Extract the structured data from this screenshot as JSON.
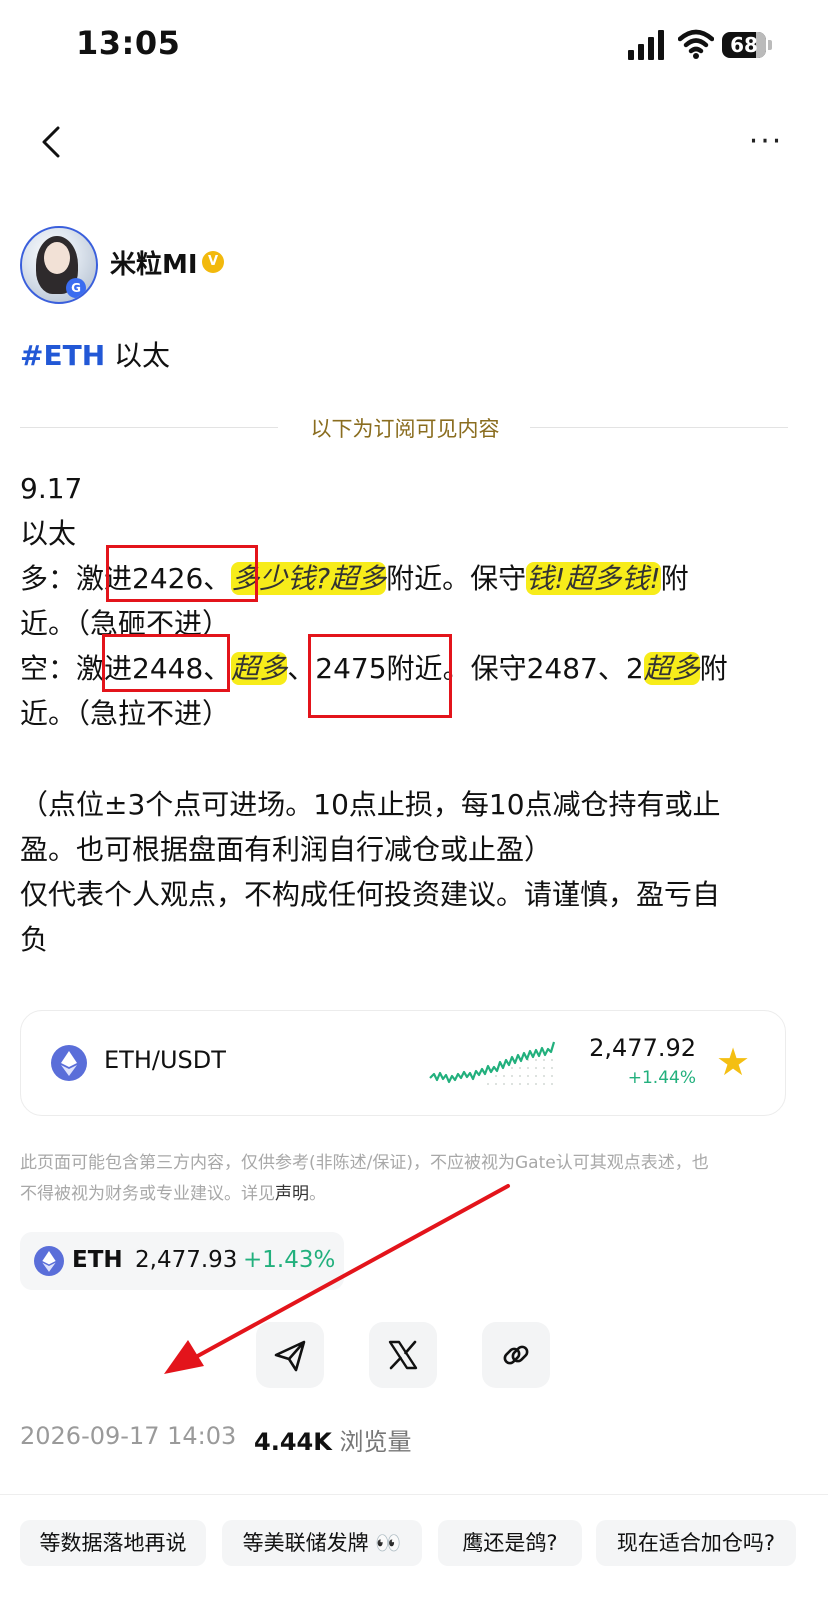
{
  "status": {
    "time": "13:05",
    "battery": "68"
  },
  "nav": {
    "back_icon": "chevron-left-icon",
    "more_label": "···"
  },
  "author": {
    "name": "米粒MI",
    "verified_badge": "V"
  },
  "post": {
    "hashtag": "#ETH",
    "tag_suffix": " 以太",
    "divider_text": "以下为订阅可见内容",
    "date_line": "9.17",
    "asset_line": "以太",
    "long_prefix": "多：激",
    "long_1": "进2426、",
    "long_hidden_1": "多少钱?超多",
    "long_near": "附近。保守",
    "long_hidden_2": "钱!超多钱!",
    "long_end": "附",
    "long_line2": "近。（急砸不进）",
    "short_prefix": "空：激",
    "short_1": "进2448、",
    "short_hidden_1": "超多",
    "short_2": "、2475附近",
    "short_mid": "。保守2487、2",
    "short_hidden_2": "超多",
    "short_end": "附",
    "short_line2": "近。（急拉不进）",
    "note_1": "（点位±3个点可进场。10点止损，每10点减仓持有或止",
    "note_2": "盈。也可根据盘面有利润自行减仓或止盈）",
    "note_3": "仅代表个人观点，不构成任何投资建议。请谨慎，盈亏自",
    "note_4": "负"
  },
  "ticker_card": {
    "pair": "ETH/USDT",
    "price": "2,477.92",
    "change": "+1.44%"
  },
  "disclaimer": {
    "line_1": "此页面可能包含第三方内容，仅供参考(非陈述/保证)，不应被视为Gate认可其观点表述，也",
    "line_2": "不得被视为财务或专业建议。详见",
    "link": "声明",
    "end": "。"
  },
  "coin_chip": {
    "symbol": "ETH",
    "price": "2,477.93",
    "change": "+1.43%"
  },
  "share": {
    "icons": [
      "telegram-icon",
      "x-icon",
      "link-icon"
    ]
  },
  "meta": {
    "timestamp": "2026-09-17 14:03",
    "views_count": "4.44K",
    "views_label": "浏览量"
  },
  "topics": [
    "等数据落地再说",
    "等美联储发牌 👀",
    "鹰还是鸽?",
    "现在适合加仓吗?"
  ],
  "colors": {
    "accent_blue": "#2258d6",
    "gold": "#8a6d1f",
    "green": "#22b07d",
    "annotation_red": "#e3141b",
    "highlight_yellow": "#f7ec1a"
  }
}
